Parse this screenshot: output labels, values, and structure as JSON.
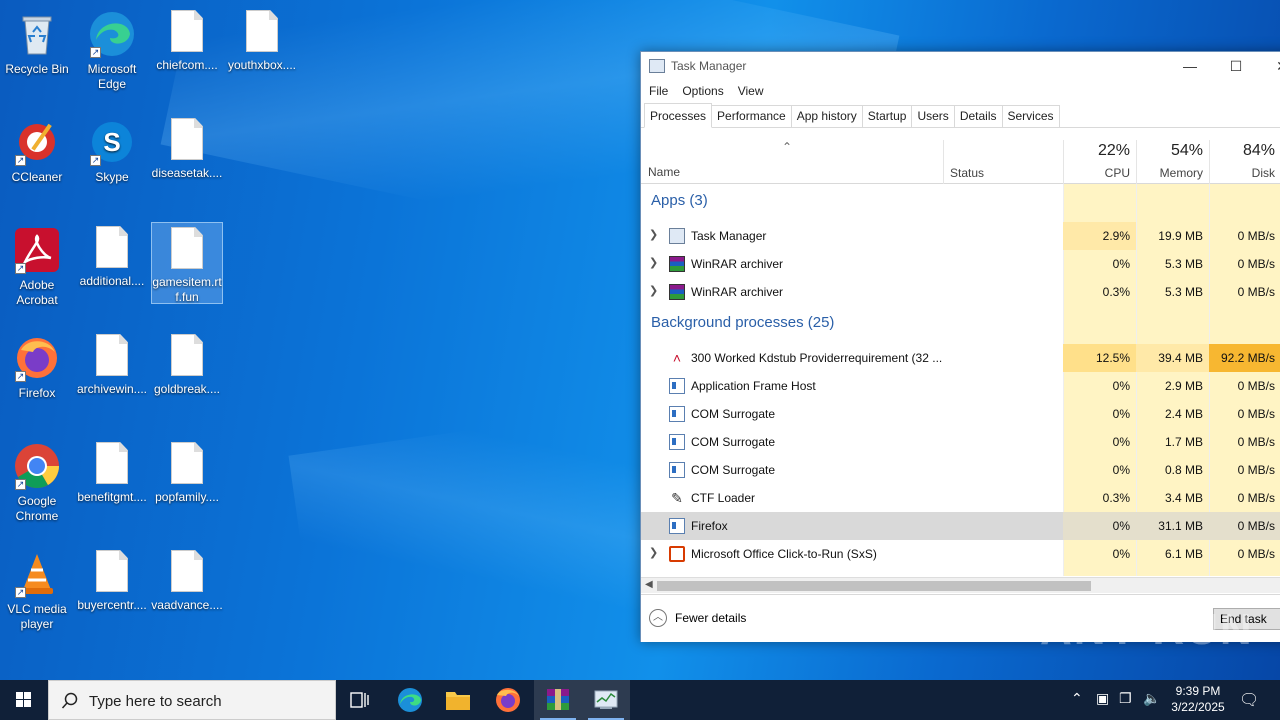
{
  "desktop": {
    "icons": [
      {
        "label": "Recycle Bin"
      },
      {
        "label": "Microsoft Edge"
      },
      {
        "label": "chiefcom...."
      },
      {
        "label": "youthxbox...."
      },
      {
        "label": "CCleaner"
      },
      {
        "label": "Skype"
      },
      {
        "label": "diseasetak...."
      },
      {
        "label": "Adobe Acrobat"
      },
      {
        "label": "additional...."
      },
      {
        "label": "gamesitem.rtf.fun"
      },
      {
        "label": "Firefox"
      },
      {
        "label": "archivewin...."
      },
      {
        "label": "goldbreak...."
      },
      {
        "label": "Google Chrome"
      },
      {
        "label": "benefitgmt...."
      },
      {
        "label": "popfamily...."
      },
      {
        "label": "VLC media player"
      },
      {
        "label": "buyercentr...."
      },
      {
        "label": "vaadvance...."
      }
    ]
  },
  "task_manager": {
    "title": "Task Manager",
    "menu": [
      "File",
      "Options",
      "View"
    ],
    "tabs": [
      "Processes",
      "Performance",
      "App history",
      "Startup",
      "Users",
      "Details",
      "Services"
    ],
    "columns": {
      "name": "Name",
      "status": "Status",
      "cpu_pct": "22%",
      "cpu": "CPU",
      "mem_pct": "54%",
      "mem": "Memory",
      "disk_pct": "84%",
      "disk": "Disk"
    },
    "groups": {
      "apps": "Apps (3)",
      "background": "Background processes (25)"
    },
    "apps": [
      {
        "name": "Task Manager",
        "cpu": "2.9%",
        "mem": "19.9 MB",
        "disk": "0 MB/s"
      },
      {
        "name": "WinRAR archiver",
        "cpu": "0%",
        "mem": "5.3 MB",
        "disk": "0 MB/s"
      },
      {
        "name": "WinRAR archiver",
        "cpu": "0.3%",
        "mem": "5.3 MB",
        "disk": "0 MB/s"
      }
    ],
    "background": [
      {
        "name": "300 Worked Kdstub Providerrequirement (32 ...",
        "cpu": "12.5%",
        "mem": "39.4 MB",
        "disk": "92.2 MB/s"
      },
      {
        "name": "Application Frame Host",
        "cpu": "0%",
        "mem": "2.9 MB",
        "disk": "0 MB/s"
      },
      {
        "name": "COM Surrogate",
        "cpu": "0%",
        "mem": "2.4 MB",
        "disk": "0 MB/s"
      },
      {
        "name": "COM Surrogate",
        "cpu": "0%",
        "mem": "1.7 MB",
        "disk": "0 MB/s"
      },
      {
        "name": "COM Surrogate",
        "cpu": "0%",
        "mem": "0.8 MB",
        "disk": "0 MB/s"
      },
      {
        "name": "CTF Loader",
        "cpu": "0.3%",
        "mem": "3.4 MB",
        "disk": "0 MB/s"
      },
      {
        "name": "Firefox",
        "cpu": "0%",
        "mem": "31.1 MB",
        "disk": "0 MB/s"
      },
      {
        "name": "Microsoft Office Click-to-Run (SxS)",
        "cpu": "0%",
        "mem": "6.1 MB",
        "disk": "0 MB/s"
      }
    ],
    "fewer_details": "Fewer details",
    "end_task": "End task"
  },
  "taskbar": {
    "search_placeholder": "Type here to search",
    "time": "9:39 PM",
    "date": "3/22/2025"
  },
  "watermark": "ANY RUN"
}
